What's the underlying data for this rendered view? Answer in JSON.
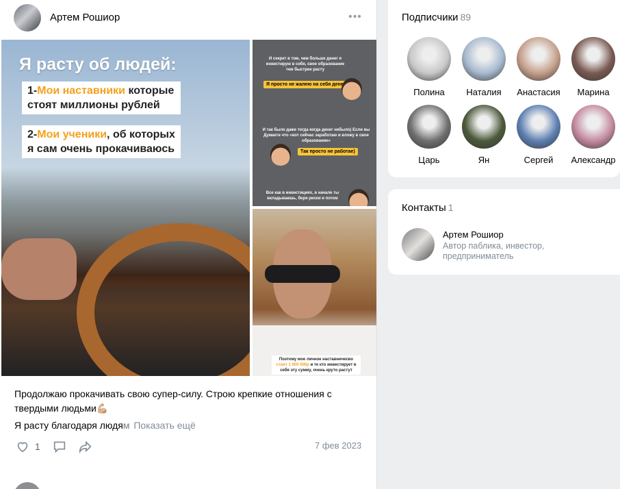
{
  "post": {
    "author": "Артем Рошиор",
    "more_label": "•••",
    "main_image": {
      "headline": "Я расту об людей:",
      "point1_prefix": "1-",
      "point1_highlight": "Мои наставники",
      "point1_rest": " которые стоят миллионы рублей",
      "point2_prefix": "2-",
      "point2_highlight": "Мои ученики",
      "point2_rest": ", об которых я сам очень прокачиваюсь"
    },
    "side_image_top": {
      "text1": "И секрет в том, чем больше денег я инвестирую в себя, свое образование тем быстрее расту",
      "pill1": "Я просто не жалею на себя денег)",
      "text2": "И так было даже тогда когда денег небыло) Если вы Думаете что «вот сейчас заработаю и вложу в свое образование»",
      "pill2": "Так просто не работае)",
      "text3": "Все как в инвестициях, в начале ты вкладываешь, беря риски и потом"
    },
    "side_image_bottom": {
      "caption_part1": "Поэтому мое личное наставничесво",
      "caption_highlight": "стоит 1 000 000р",
      "caption_part2": "и те кто инвестирует в себя эту сумму, очень круто растут"
    },
    "text_line1": "Продолжаю прокачивать свою супер-силу. Строю крепкие отношения с твердыми людьми💪🏼",
    "text_line2": "Я расту благодаря людя",
    "text_line2_fade": "м",
    "show_more": "Показать ещё",
    "likes": "1",
    "date": "7 фев 2023"
  },
  "subscribers": {
    "title": "Подписчики",
    "count": "89",
    "items": [
      {
        "name": "Полина",
        "color": "#c8c8c8"
      },
      {
        "name": "Наталия",
        "color": "#a7b9cf"
      },
      {
        "name": "Анастасия",
        "color": "#c59f8b"
      },
      {
        "name": "Марина",
        "color": "#7a5a52"
      },
      {
        "name": "Царь",
        "color": "#6f6f6f"
      },
      {
        "name": "Ян",
        "color": "#4c5a3b"
      },
      {
        "name": "Сергей",
        "color": "#5d7fb2"
      },
      {
        "name": "Александр",
        "color": "#c48aa0"
      }
    ]
  },
  "contacts": {
    "title": "Контакты",
    "count": "1",
    "name": "Артем Рошиор",
    "role": "Автор паблика, инвестор, предприниматель"
  }
}
